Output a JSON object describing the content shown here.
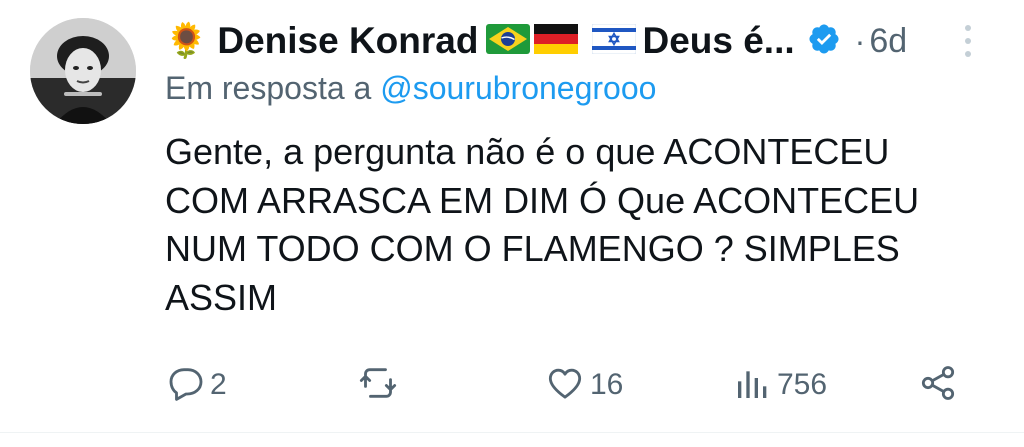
{
  "author": {
    "display_name_prefix_emoji": "🌻",
    "display_name": "Denise Konrad",
    "display_name_suffix": "Deus é...",
    "flags": [
      "brazil-flag",
      "germany-flag",
      "israel-flag"
    ],
    "verified": true,
    "timestamp": "6d"
  },
  "reply": {
    "prefix": "Em resposta a",
    "handle": "@sourubronegrooo"
  },
  "tweet": {
    "lines": [
      "Gente, a pergunta não é o que ACONTECEU",
      "COM ARRASCA EM DIM Ó Que ACONTECEU",
      "NUM TODO COM O FLAMENGO ? SIMPLES",
      "ASSIM"
    ]
  },
  "actions": {
    "replies": "2",
    "retweets": "",
    "likes": "16",
    "views": "756"
  },
  "icons": {
    "reply": "speech-bubble-icon",
    "retweet": "retweet-icon",
    "like": "heart-icon",
    "views": "bar-chart-icon",
    "share": "share-icon",
    "more": "more-vertical-icon"
  },
  "colors": {
    "text": "#0f1419",
    "secondary": "#536471",
    "link": "#1d9bf0",
    "verified": "#1d9bf0"
  }
}
